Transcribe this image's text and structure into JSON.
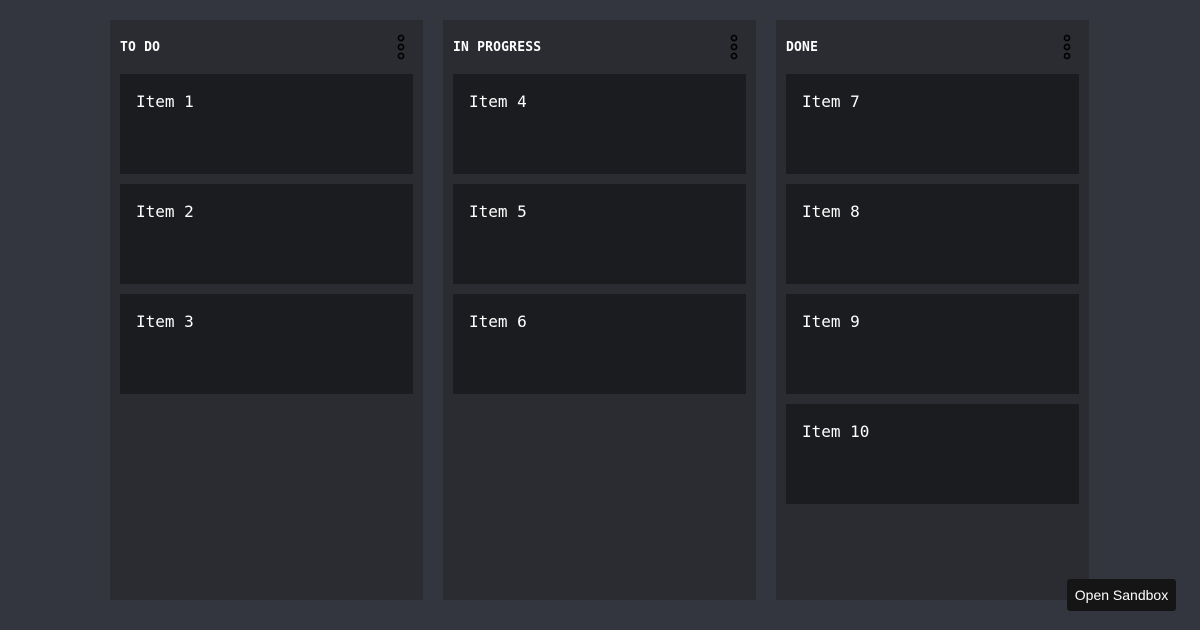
{
  "board": {
    "columns": [
      {
        "title": "TO DO",
        "menu_icon": "kebab-menu-icon",
        "items": [
          "Item 1",
          "Item 2",
          "Item 3"
        ]
      },
      {
        "title": "IN PROGRESS",
        "menu_icon": "kebab-menu-icon",
        "items": [
          "Item 4",
          "Item 5",
          "Item 6"
        ]
      },
      {
        "title": "DONE",
        "menu_icon": "kebab-menu-icon",
        "items": [
          "Item 7",
          "Item 8",
          "Item 9",
          "Item 10"
        ]
      }
    ]
  },
  "sandbox_button": {
    "label": "Open Sandbox"
  },
  "colors": {
    "page_bg": "#33363e",
    "column_bg": "#2a2c31",
    "card_bg": "#1b1c1f",
    "text": "#ffffff"
  }
}
